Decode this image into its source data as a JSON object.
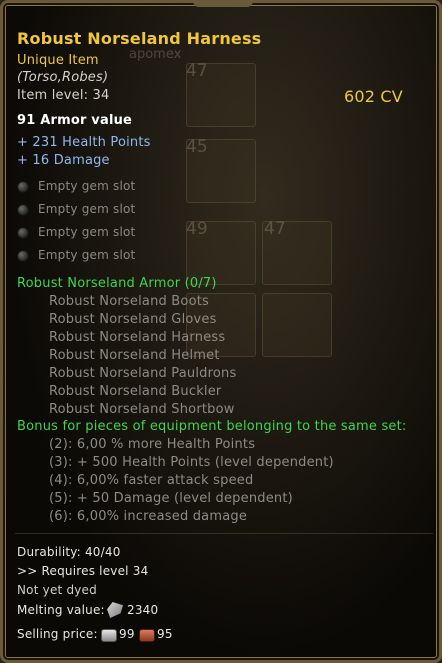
{
  "item": {
    "name": "Robust Norseland Harness",
    "rarity": "Unique Item",
    "type": "(Torso,Robes)",
    "item_level": "Item level: 34",
    "combat_value": "602 CV",
    "armor": "91 Armor value",
    "bonuses": [
      "+ 231 Health Points",
      "+ 16 Damage"
    ],
    "gem_slots": [
      "Empty gem slot",
      "Empty gem slot",
      "Empty gem slot",
      "Empty gem slot"
    ]
  },
  "set": {
    "name": "Robust Norseland Armor (0/7)",
    "pieces": [
      "Robust Norseland Boots",
      "Robust Norseland Gloves",
      "Robust Norseland Harness",
      "Robust Norseland Helmet",
      "Robust Norseland Pauldrons",
      "Robust Norseland Buckler",
      "Robust Norseland Shortbow"
    ],
    "bonus_header": "Bonus for pieces of equipment belonging to the same set:",
    "bonuses": [
      "(2): 6,00 % more Health Points",
      "(3): + 500 Health Points (level dependent)",
      "(4): 6,00% faster attack speed",
      "(5): + 50 Damage (level dependent)",
      "(6): 6,00% increased damage"
    ]
  },
  "footer": {
    "durability": "Durability: 40/40",
    "requires": ">> Requires level 34",
    "dyed": "Not yet dyed",
    "melting_label": "Melting value:",
    "melting_value": "2340",
    "selling_label": "Selling price:",
    "selling_silver": "99",
    "selling_copper": "95"
  },
  "background": {
    "slot_numbers": [
      "47",
      "45",
      "49",
      "47"
    ],
    "faint_text": "apomex"
  },
  "colors": {
    "title": "#f0c73c",
    "bonus": "#8fb8f0",
    "set": "#3fd64a",
    "inactive": "#8d8b84"
  }
}
